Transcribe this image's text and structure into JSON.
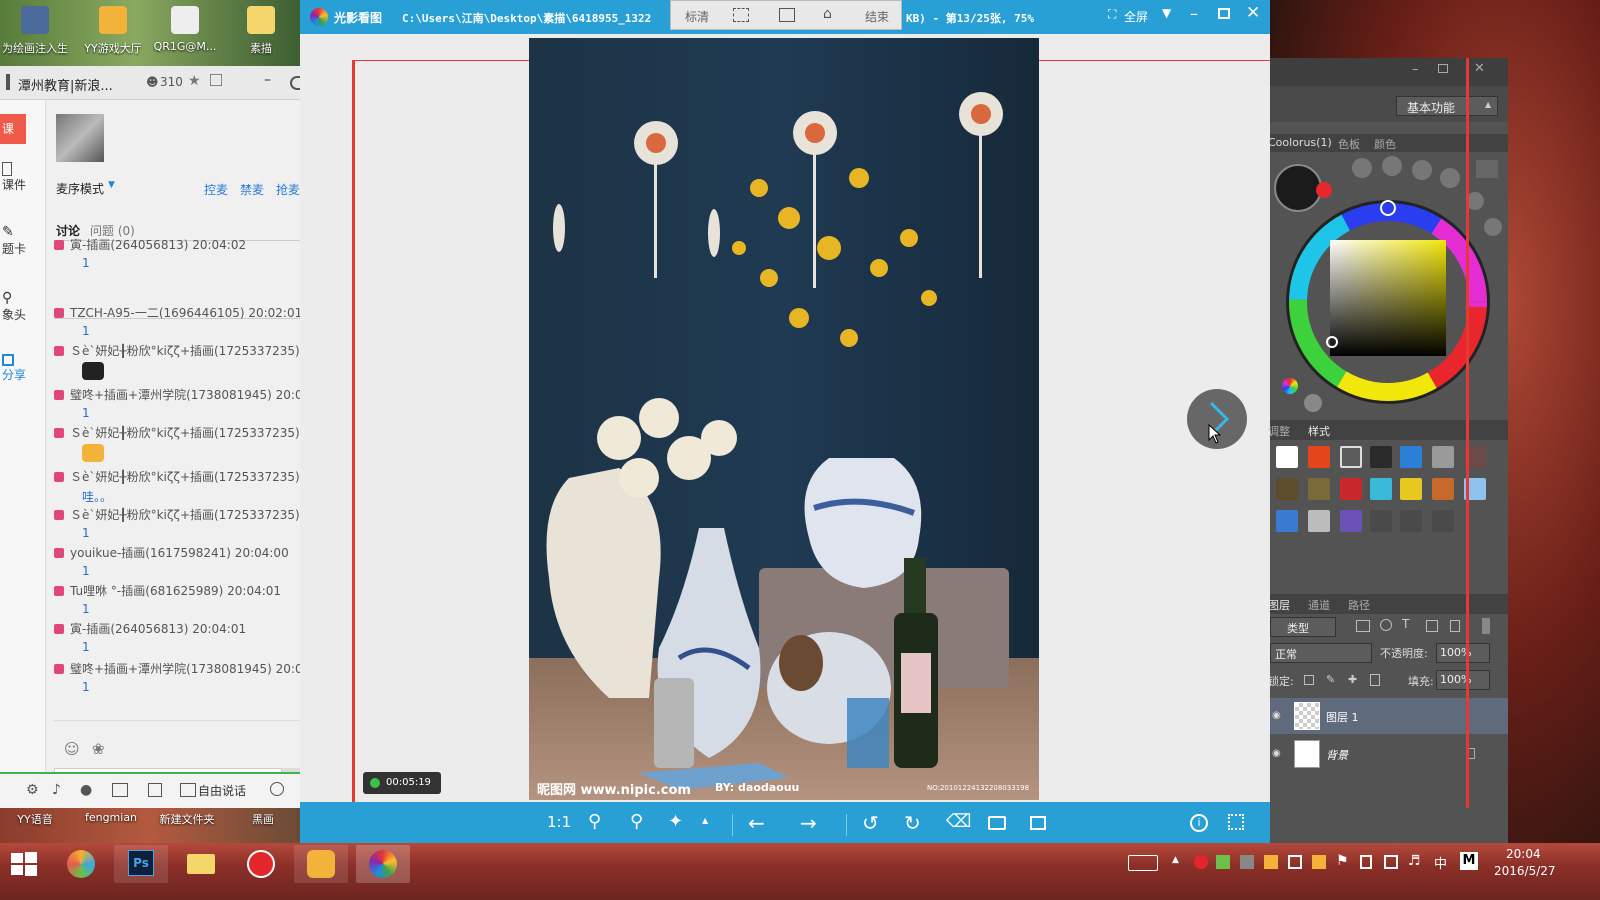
{
  "desktop": {
    "icons": [
      {
        "label": "为绘画注入生"
      },
      {
        "label": "YY游戏大厅"
      },
      {
        "label": "QR1G@M..."
      },
      {
        "label": "素描"
      }
    ],
    "bottom_labels": [
      "YY语音",
      "fengmian",
      "新建文件夹",
      "黑画"
    ]
  },
  "class_panel": {
    "title": "潭州教育|新浪...",
    "viewer_count": "310",
    "rail": {
      "class_label": "课",
      "courseware": "课件",
      "card": "题卡",
      "camera": "象头",
      "share": "分享"
    },
    "mode_label": "麦序模式",
    "mic_actions": [
      "控麦",
      "禁麦",
      "抢麦"
    ],
    "tabs": {
      "discuss": "讨论",
      "questions": "问题 (0)"
    },
    "messages": [
      {
        "user": "寅-插画(264056813) 20:04:02",
        "body": "1"
      },
      {
        "user": "TZCH-A95-一二(1696446105) 20:02:01",
        "body": "1"
      },
      {
        "user": "Ｓè`妍妃╂粉欣°kiζζ+插画(1725337235)",
        "body": "emoji-panda"
      },
      {
        "user": "璧咚+插画+潭州学院(1738081945) 20:0",
        "body": "1"
      },
      {
        "user": "Ｓè`妍妃╂粉欣°kiζζ+插画(1725337235)",
        "body": "emoji-cat"
      },
      {
        "user": "Ｓè`妍妃╂粉欣°kiζζ+插画(1725337235)",
        "body": "哇。。"
      },
      {
        "user": "Ｓè`妍妃╂粉欣°kiζζ+插画(1725337235)",
        "body": "1"
      },
      {
        "user": "youikue-插画(1617598241) 20:04:00",
        "body": "1"
      },
      {
        "user": "Tu哩咻 °-插画(681625989) 20:04:01",
        "body": "1"
      },
      {
        "user": "寅-插画(264056813) 20:04:01",
        "body": "1"
      },
      {
        "user": "璧咚+插画+潭州学院(1738081945) 20:0",
        "body": "1"
      }
    ],
    "toolbar": {
      "free_talk": "自由说话"
    }
  },
  "viewer": {
    "app_name": "光影看图",
    "path": "C:\\Users\\江南\\Desktop\\素描\\6418955_1322",
    "status": "KB) - 第13/25张, 75%",
    "mode_buttons": [
      "标清",
      "",
      "",
      "",
      "结束"
    ],
    "fullscreen": "全屏",
    "zoom_ratio": "1:1",
    "timer": "00:05:19",
    "watermark": "昵图网 www.nipic.com",
    "author": "BY: daodaouu",
    "photo_no": "NO:20101224132208033198"
  },
  "photoshop": {
    "workspace": "基本功能",
    "color_tabs": [
      "Coolorus(1)",
      "色板",
      "颜色"
    ],
    "style_tabs": [
      "调整",
      "样式"
    ],
    "layer_tabs": [
      "图层",
      "通道",
      "路径"
    ],
    "filter_kind": "类型",
    "blend_mode": "正常",
    "opacity_label": "不透明度:",
    "opacity_value": "100%",
    "lock_label": "锁定:",
    "fill_label": "填充:",
    "fill_value": "100%",
    "layers": [
      {
        "name": "图层 1"
      },
      {
        "name": "背景"
      }
    ],
    "colors": {
      "foreground": "#1b1b1b",
      "accent": "#e8262b"
    }
  },
  "taskbar": {
    "time": "20:04",
    "date": "2016/5/27",
    "ime": "中",
    "ime2": "M"
  },
  "colors": {
    "viewer_blue": "#28a0d5",
    "recording_red": "#e53935"
  }
}
